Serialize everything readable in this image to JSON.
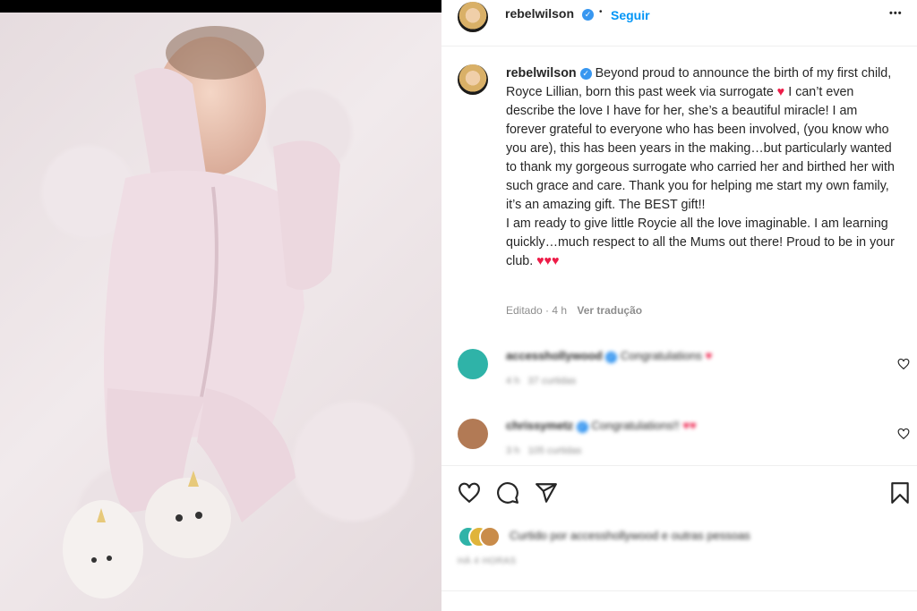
{
  "post": {
    "username": "rebelwilson",
    "verified_mark": "✓",
    "separator": "•",
    "follow_label": "Seguir",
    "more_label": "•••"
  },
  "caption": {
    "username": "rebelwilson",
    "p1a": "Beyond proud to announce the birth of my first child, Royce Lillian, born this past week via surrogate",
    "p1b": "I can’t even describe the love I have for her, she’s a beautiful miracle! I am forever grateful to everyone who has been involved, (you know who you are), this has been years in the making…but particularly wanted to thank my gorgeous surrogate who carried her and birthed her with such grace and care. Thank you for helping me start my own family, it’s an amazing gift. The BEST gift!!",
    "p2": "I am ready to give little Roycie all the love imaginable. I am learning quickly…much respect to all the Mums out there! Proud to be in your club.",
    "heart": "♥",
    "hearts": "♥♥♥"
  },
  "meta": {
    "edited": "Editado · 4 h",
    "translate": "Ver tradução"
  },
  "comments": [
    {
      "username": "accesshollywood",
      "text": "Congratulations",
      "emoji": "♥",
      "age": "4 h",
      "likes": "37 curtidas"
    },
    {
      "username": "chrissymetz",
      "text": "Congratulations!!",
      "emoji": "♥♥",
      "age": "3 h",
      "likes": "105 curtidas"
    }
  ],
  "actions": {
    "like_icon": "heart-outline-icon",
    "comment_icon": "comment-icon",
    "share_icon": "paper-plane-icon",
    "save_icon": "bookmark-icon"
  },
  "likes": {
    "text": "Curtido por accesshollywood e outras pessoas"
  },
  "date": "HÁ 4 HORAS",
  "colors": {
    "accent": "#0095f6",
    "verified": "#3897f0",
    "heart": "#ed1c48",
    "muted": "#8e8e8e"
  }
}
